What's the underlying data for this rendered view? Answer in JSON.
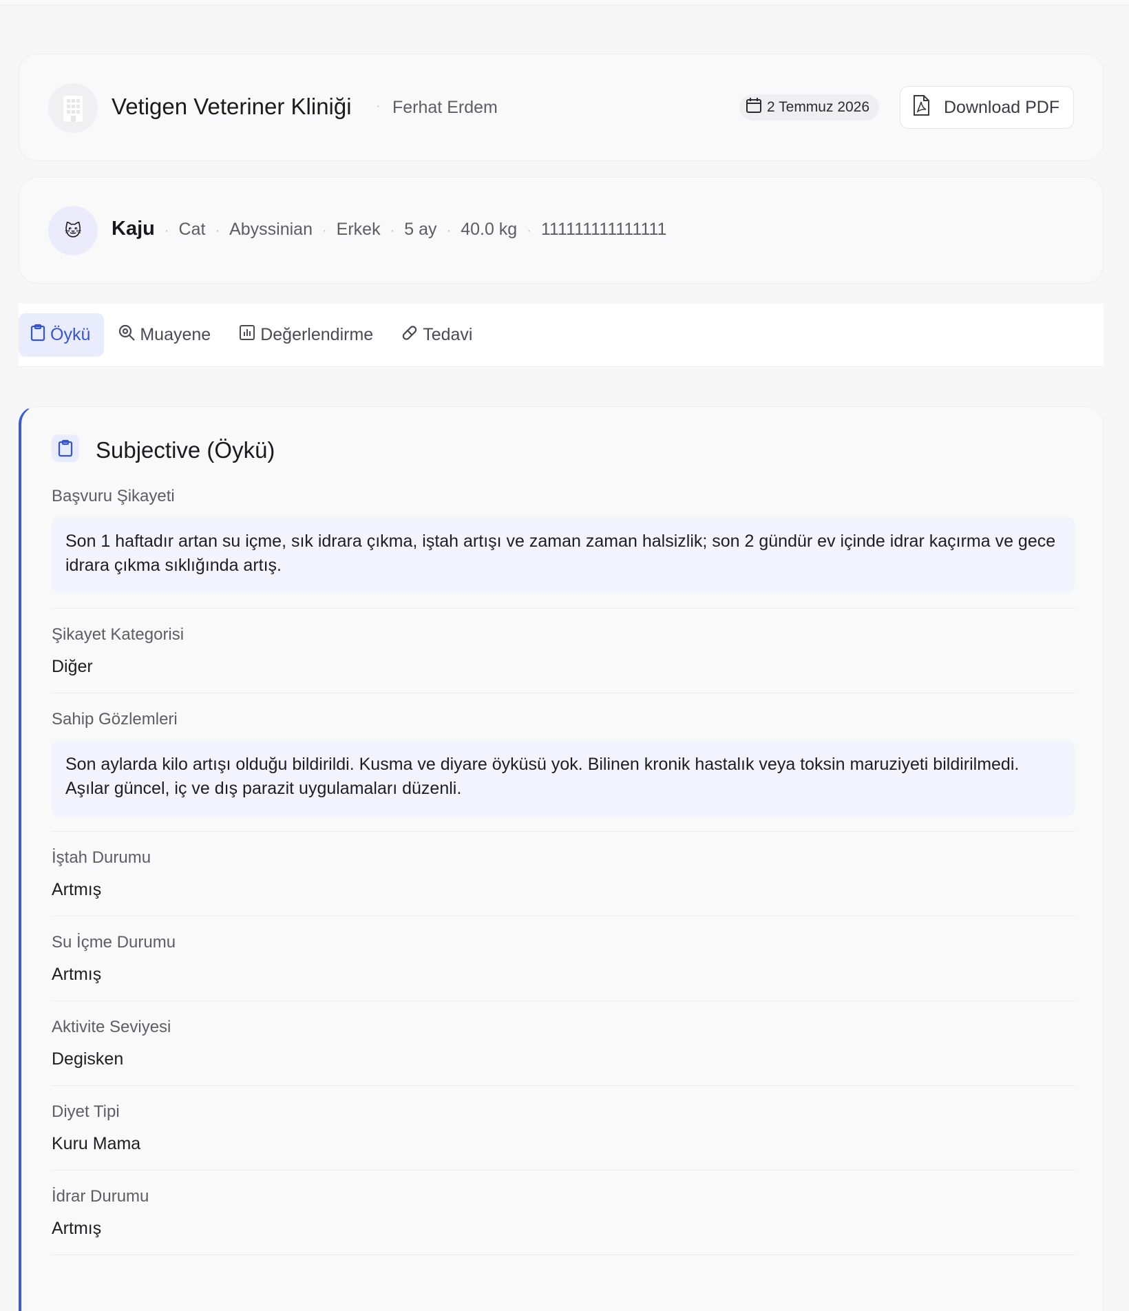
{
  "header": {
    "clinic_name": "Vetigen Veteriner Kliniği",
    "separator": "·",
    "vet_name": "Ferhat Erdem",
    "date": "2 Temmuz 2026",
    "pdf_button": "Download PDF",
    "logo_icon": "building-icon",
    "date_icon": "calendar-icon",
    "pdf_icon": "pdf-file-icon"
  },
  "patient": {
    "avatar": "🐱",
    "name": "Kaju",
    "species": "Cat",
    "breed": "Abyssinian",
    "sex": "Erkek",
    "age": "5 ay",
    "weight": "40.0 kg",
    "chip": "111111111111111"
  },
  "tabs": [
    {
      "label": "Öykü",
      "icon": "clipboard-icon",
      "active": true
    },
    {
      "label": "Muayene",
      "icon": "magnify-icon",
      "active": false
    },
    {
      "label": "Değerlendirme",
      "icon": "chart-icon",
      "active": false
    },
    {
      "label": "Tedavi",
      "icon": "pill-icon",
      "active": false
    }
  ],
  "section": {
    "title": "Subjective (Öykü)",
    "icon": "clipboard-icon",
    "fields": [
      {
        "label": "Başvuru Şikayeti",
        "value": "Son 1 haftadır artan su içme, sık idrara çıkma, iştah artışı ve zaman zaman halsizlik; son 2 gündür ev içinde idrar kaçırma ve gece idrara çıkma sıklığında artış.",
        "boxed": true
      },
      {
        "label": "Şikayet Kategorisi",
        "value": "Diğer",
        "boxed": false
      },
      {
        "label": "Sahip Gözlemleri",
        "value": "Son aylarda kilo artışı olduğu bildirildi. Kusma ve diyare öyküsü yok. Bilinen kronik hastalık veya toksin maruziyeti bildirilmedi. Aşılar güncel, iç ve dış parazit uygulamaları düzenli.",
        "boxed": true
      },
      {
        "label": "İştah Durumu",
        "value": "Artmış",
        "boxed": false
      },
      {
        "label": "Su İçme Durumu",
        "value": "Artmış",
        "boxed": false
      },
      {
        "label": "Aktivite Seviyesi",
        "value": "Degisken",
        "boxed": false
      },
      {
        "label": "Diyet Tipi",
        "value": "Kuru Mama",
        "boxed": false
      },
      {
        "label": "İdrar Durumu",
        "value": "Artmış",
        "boxed": false
      }
    ]
  },
  "colors": {
    "accent": "#3b5bdb",
    "accent_bg": "#e9ecfd",
    "page_bg": "#f7f7f8"
  }
}
